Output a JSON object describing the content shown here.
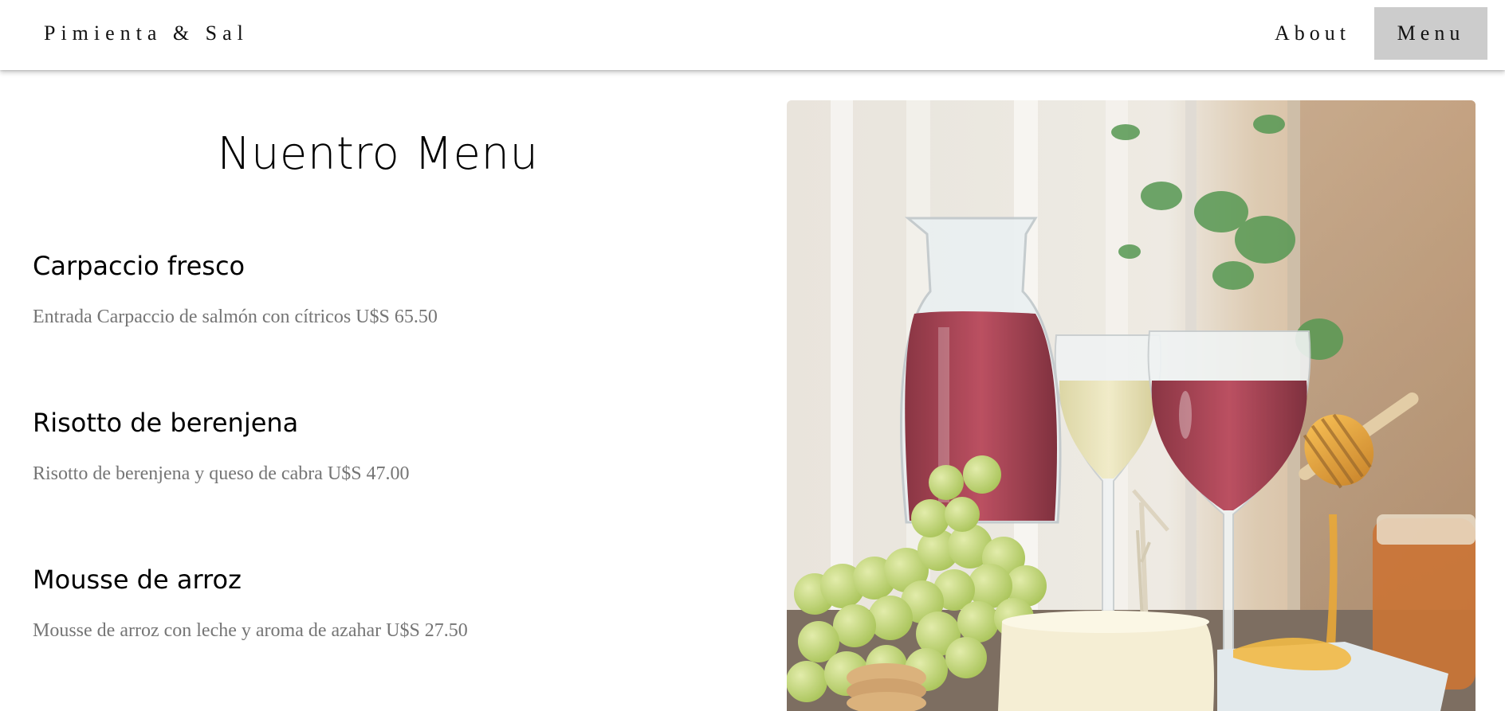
{
  "header": {
    "brand": "Pimienta & Sal",
    "nav": [
      {
        "label": "About",
        "active": false
      },
      {
        "label": "Menu",
        "active": true
      }
    ]
  },
  "main": {
    "title": "Nuentro Menu",
    "dishes": [
      {
        "name": "Carpaccio fresco",
        "description": "Entrada Carpaccio de salmón con cítricos U$S 65.50"
      },
      {
        "name": "Risotto de berenjena",
        "description": "Risotto de berenjena y queso de cabra U$S 47.00"
      },
      {
        "name": "Mousse de arroz",
        "description": "Mousse de arroz con leche y aroma de azahar U$S 27.50"
      }
    ]
  },
  "image": {
    "subject": "wine carafe, wine glasses, green grapes, cheese, crackers and honey dipper"
  },
  "colors": {
    "nav_active_bg": "#cccccc",
    "description_text": "#757575",
    "heading_text": "#000000"
  }
}
